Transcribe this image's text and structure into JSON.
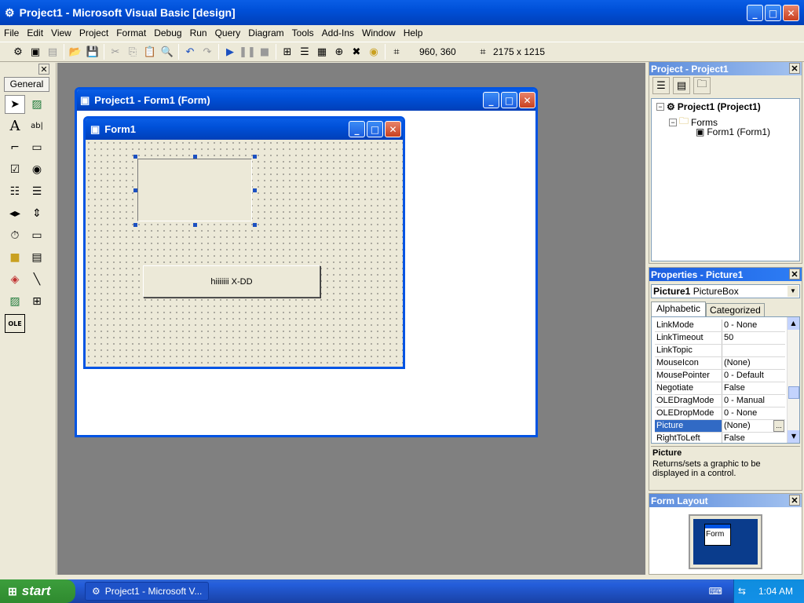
{
  "app": {
    "title": "Project1 - Microsoft Visual Basic [design]"
  },
  "menu": [
    "File",
    "Edit",
    "View",
    "Project",
    "Format",
    "Debug",
    "Run",
    "Query",
    "Diagram",
    "Tools",
    "Add-Ins",
    "Window",
    "Help"
  ],
  "toolbar": {
    "position": "960, 360",
    "size": "2175 x 1215"
  },
  "toolbox": {
    "tab": "General"
  },
  "formDesigner": {
    "title": "Project1 - Form1 (Form)",
    "innerTitle": "Form1",
    "buttonCaption": "hiiiiiii X-DD"
  },
  "projectPanel": {
    "title": "Project - Project1",
    "root": "Project1 (Project1)",
    "folder": "Forms",
    "item": "Form1 (Form1)"
  },
  "propertiesPanel": {
    "title": "Properties - Picture1",
    "objectName": "Picture1",
    "objectType": "PictureBox",
    "tabs": [
      "Alphabetic",
      "Categorized"
    ],
    "rows": [
      {
        "key": "LinkMode",
        "value": "0 - None"
      },
      {
        "key": "LinkTimeout",
        "value": "50"
      },
      {
        "key": "LinkTopic",
        "value": ""
      },
      {
        "key": "MouseIcon",
        "value": "(None)"
      },
      {
        "key": "MousePointer",
        "value": "0 - Default"
      },
      {
        "key": "Negotiate",
        "value": "False"
      },
      {
        "key": "OLEDragMode",
        "value": "0 - Manual"
      },
      {
        "key": "OLEDropMode",
        "value": "0 - None"
      },
      {
        "key": "Picture",
        "value": "(None)"
      },
      {
        "key": "RightToLeft",
        "value": "False"
      }
    ],
    "descTitle": "Picture",
    "descText": "Returns/sets a graphic to be displayed in a control."
  },
  "formLayout": {
    "title": "Form Layout",
    "formLabel": "Form"
  },
  "taskbar": {
    "start": "start",
    "task": "Project1 - Microsoft V...",
    "time": "1:04 AM"
  }
}
